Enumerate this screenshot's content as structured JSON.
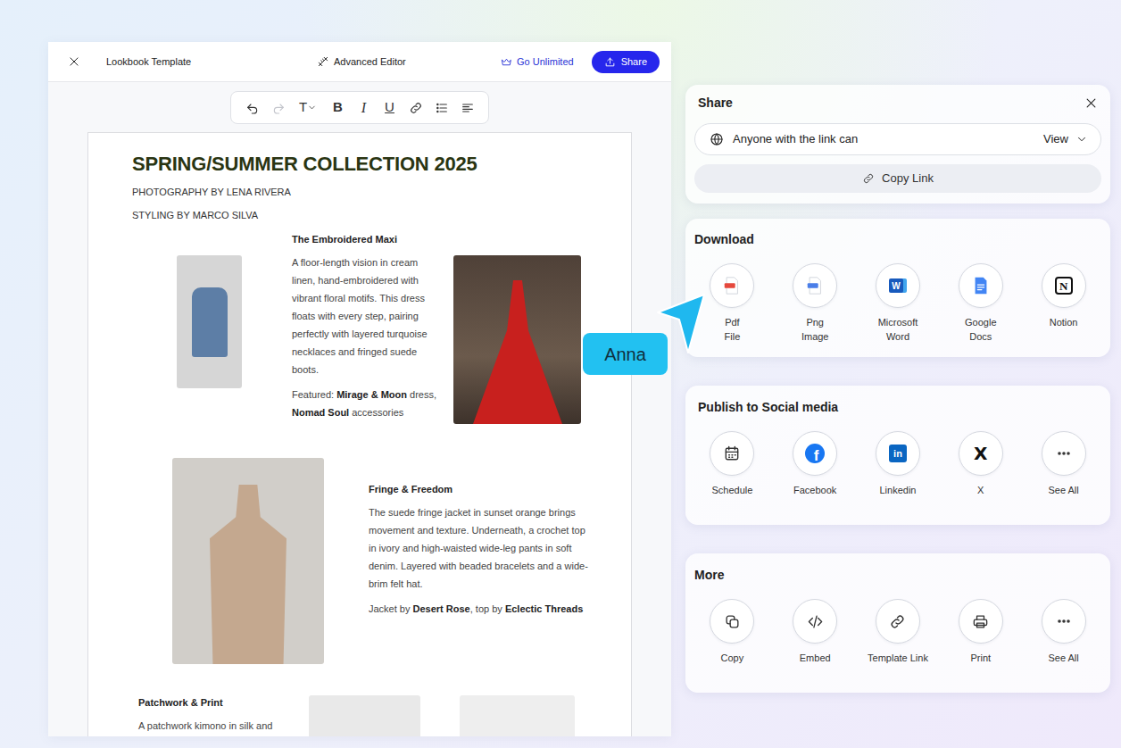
{
  "editor": {
    "title": "Lookbook Template",
    "advanced_editor": "Advanced Editor",
    "go_unlimited": "Go Unlimited",
    "share_button": "Share"
  },
  "toolbar": [
    {
      "kind": "undo",
      "disabled": false
    },
    {
      "kind": "redo",
      "disabled": true
    },
    {
      "kind": "text-style",
      "label": "T"
    },
    {
      "kind": "bold",
      "label": "B"
    },
    {
      "kind": "italic",
      "label": "I"
    },
    {
      "kind": "underline",
      "label": "U"
    },
    {
      "kind": "link"
    },
    {
      "kind": "list"
    },
    {
      "kind": "align"
    }
  ],
  "document": {
    "title": "SPRING/SUMMER COLLECTION 2025",
    "credits": [
      "PHOTOGRAPHY BY LENA RIVERA",
      "STYLING BY MARCO SILVA"
    ],
    "sections": [
      {
        "kind": "thumb-text-photo",
        "title": "The Embroidered Maxi",
        "body": "A floor-length vision in cream linen, hand-embroidered with vibrant floral motifs. This dress floats with every step, pairing perfectly with layered turquoise necklaces and fringed suede boots.",
        "credit": [
          {
            "text": "Featured: ",
            "bold": false
          },
          {
            "text": "Mirage & Moon",
            "bold": true
          },
          {
            "text": " dress, ",
            "bold": false
          },
          {
            "text": "Nomad Soul",
            "bold": true
          },
          {
            "text": " accessories",
            "bold": false
          }
        ]
      },
      {
        "kind": "photo-text",
        "title": "Fringe & Freedom",
        "body": "The suede fringe jacket in sunset orange brings movement and texture. Underneath, a crochet top in ivory and high-waisted wide-leg pants in soft denim. Layered with beaded bracelets and a wide-brim felt hat.",
        "credit": [
          {
            "text": "Jacket by ",
            "bold": false
          },
          {
            "text": "Desert Rose",
            "bold": true
          },
          {
            "text": ", top by ",
            "bold": false
          },
          {
            "text": "Eclectic Threads",
            "bold": true
          }
        ]
      },
      {
        "kind": "text-photos",
        "title": "Patchwork & Print",
        "body": "A patchwork kimono in silk and",
        "credit": []
      }
    ]
  },
  "share": {
    "title": "Share",
    "access": "Anyone with the link can",
    "permission": "View",
    "copy_link": "Copy Link"
  },
  "download": {
    "title": "Download",
    "items": [
      {
        "kind": "pdf",
        "label": "Pdf File"
      },
      {
        "kind": "png",
        "label": "Png Image"
      },
      {
        "kind": "word",
        "label": "Microsoft Word",
        "glyph": "W"
      },
      {
        "kind": "gdocs",
        "label": "Google Docs"
      },
      {
        "kind": "notion",
        "label": "Notion",
        "glyph": "N"
      }
    ]
  },
  "social": {
    "title": "Publish to Social media",
    "items": [
      {
        "kind": "schedule",
        "label": "Schedule"
      },
      {
        "kind": "facebook",
        "label": "Facebook",
        "glyph": "f"
      },
      {
        "kind": "linkedin",
        "label": "Linkedin",
        "glyph": "in"
      },
      {
        "kind": "x",
        "label": "X",
        "glyph": "X"
      },
      {
        "kind": "more",
        "label": "See All"
      }
    ]
  },
  "more": {
    "title": "More",
    "items": [
      {
        "kind": "copy",
        "label": "Copy"
      },
      {
        "kind": "embed",
        "label": "Embed"
      },
      {
        "kind": "link",
        "label": "Template Link"
      },
      {
        "kind": "print",
        "label": "Print"
      },
      {
        "kind": "more",
        "label": "See All"
      }
    ]
  },
  "cursor": {
    "label": "Anna"
  }
}
